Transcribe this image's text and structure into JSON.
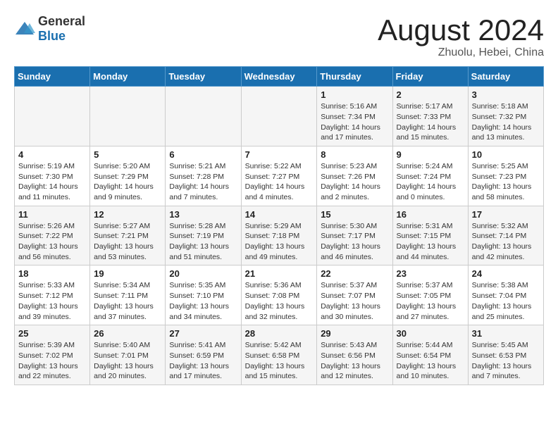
{
  "header": {
    "logo_general": "General",
    "logo_blue": "Blue",
    "month_year": "August 2024",
    "location": "Zhuolu, Hebei, China"
  },
  "days_of_week": [
    "Sunday",
    "Monday",
    "Tuesday",
    "Wednesday",
    "Thursday",
    "Friday",
    "Saturday"
  ],
  "weeks": [
    [
      {
        "day": "",
        "info": ""
      },
      {
        "day": "",
        "info": ""
      },
      {
        "day": "",
        "info": ""
      },
      {
        "day": "",
        "info": ""
      },
      {
        "day": "1",
        "info": "Sunrise: 5:16 AM\nSunset: 7:34 PM\nDaylight: 14 hours\nand 17 minutes."
      },
      {
        "day": "2",
        "info": "Sunrise: 5:17 AM\nSunset: 7:33 PM\nDaylight: 14 hours\nand 15 minutes."
      },
      {
        "day": "3",
        "info": "Sunrise: 5:18 AM\nSunset: 7:32 PM\nDaylight: 14 hours\nand 13 minutes."
      }
    ],
    [
      {
        "day": "4",
        "info": "Sunrise: 5:19 AM\nSunset: 7:30 PM\nDaylight: 14 hours\nand 11 minutes."
      },
      {
        "day": "5",
        "info": "Sunrise: 5:20 AM\nSunset: 7:29 PM\nDaylight: 14 hours\nand 9 minutes."
      },
      {
        "day": "6",
        "info": "Sunrise: 5:21 AM\nSunset: 7:28 PM\nDaylight: 14 hours\nand 7 minutes."
      },
      {
        "day": "7",
        "info": "Sunrise: 5:22 AM\nSunset: 7:27 PM\nDaylight: 14 hours\nand 4 minutes."
      },
      {
        "day": "8",
        "info": "Sunrise: 5:23 AM\nSunset: 7:26 PM\nDaylight: 14 hours\nand 2 minutes."
      },
      {
        "day": "9",
        "info": "Sunrise: 5:24 AM\nSunset: 7:24 PM\nDaylight: 14 hours\nand 0 minutes."
      },
      {
        "day": "10",
        "info": "Sunrise: 5:25 AM\nSunset: 7:23 PM\nDaylight: 13 hours\nand 58 minutes."
      }
    ],
    [
      {
        "day": "11",
        "info": "Sunrise: 5:26 AM\nSunset: 7:22 PM\nDaylight: 13 hours\nand 56 minutes."
      },
      {
        "day": "12",
        "info": "Sunrise: 5:27 AM\nSunset: 7:21 PM\nDaylight: 13 hours\nand 53 minutes."
      },
      {
        "day": "13",
        "info": "Sunrise: 5:28 AM\nSunset: 7:19 PM\nDaylight: 13 hours\nand 51 minutes."
      },
      {
        "day": "14",
        "info": "Sunrise: 5:29 AM\nSunset: 7:18 PM\nDaylight: 13 hours\nand 49 minutes."
      },
      {
        "day": "15",
        "info": "Sunrise: 5:30 AM\nSunset: 7:17 PM\nDaylight: 13 hours\nand 46 minutes."
      },
      {
        "day": "16",
        "info": "Sunrise: 5:31 AM\nSunset: 7:15 PM\nDaylight: 13 hours\nand 44 minutes."
      },
      {
        "day": "17",
        "info": "Sunrise: 5:32 AM\nSunset: 7:14 PM\nDaylight: 13 hours\nand 42 minutes."
      }
    ],
    [
      {
        "day": "18",
        "info": "Sunrise: 5:33 AM\nSunset: 7:12 PM\nDaylight: 13 hours\nand 39 minutes."
      },
      {
        "day": "19",
        "info": "Sunrise: 5:34 AM\nSunset: 7:11 PM\nDaylight: 13 hours\nand 37 minutes."
      },
      {
        "day": "20",
        "info": "Sunrise: 5:35 AM\nSunset: 7:10 PM\nDaylight: 13 hours\nand 34 minutes."
      },
      {
        "day": "21",
        "info": "Sunrise: 5:36 AM\nSunset: 7:08 PM\nDaylight: 13 hours\nand 32 minutes."
      },
      {
        "day": "22",
        "info": "Sunrise: 5:37 AM\nSunset: 7:07 PM\nDaylight: 13 hours\nand 30 minutes."
      },
      {
        "day": "23",
        "info": "Sunrise: 5:37 AM\nSunset: 7:05 PM\nDaylight: 13 hours\nand 27 minutes."
      },
      {
        "day": "24",
        "info": "Sunrise: 5:38 AM\nSunset: 7:04 PM\nDaylight: 13 hours\nand 25 minutes."
      }
    ],
    [
      {
        "day": "25",
        "info": "Sunrise: 5:39 AM\nSunset: 7:02 PM\nDaylight: 13 hours\nand 22 minutes."
      },
      {
        "day": "26",
        "info": "Sunrise: 5:40 AM\nSunset: 7:01 PM\nDaylight: 13 hours\nand 20 minutes."
      },
      {
        "day": "27",
        "info": "Sunrise: 5:41 AM\nSunset: 6:59 PM\nDaylight: 13 hours\nand 17 minutes."
      },
      {
        "day": "28",
        "info": "Sunrise: 5:42 AM\nSunset: 6:58 PM\nDaylight: 13 hours\nand 15 minutes."
      },
      {
        "day": "29",
        "info": "Sunrise: 5:43 AM\nSunset: 6:56 PM\nDaylight: 13 hours\nand 12 minutes."
      },
      {
        "day": "30",
        "info": "Sunrise: 5:44 AM\nSunset: 6:54 PM\nDaylight: 13 hours\nand 10 minutes."
      },
      {
        "day": "31",
        "info": "Sunrise: 5:45 AM\nSunset: 6:53 PM\nDaylight: 13 hours\nand 7 minutes."
      }
    ]
  ]
}
